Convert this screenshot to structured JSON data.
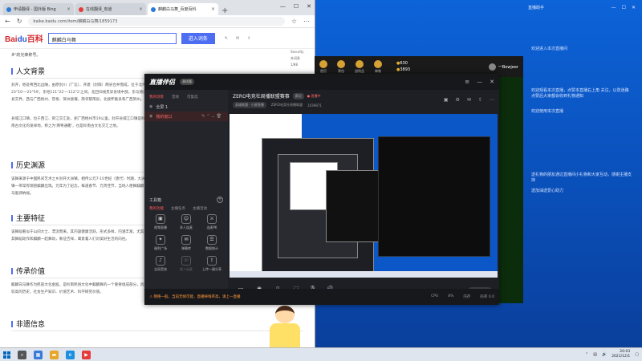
{
  "browser": {
    "tabs": [
      {
        "label": "申请翻译 - 国外版 Bing"
      },
      {
        "label": "在线翻译_有道"
      },
      {
        "label": "麒麟白马舞_百度百科"
      }
    ],
    "url": "baike.baidu.com/item/麒麟白马舞/1859173",
    "search_value": "麒麟白马舞",
    "search_button": "进入词条",
    "intro": "乡'的光荣称号。",
    "side_links": [
      "Security",
      "本词条",
      "1/88"
    ],
    "sections": [
      {
        "title": "人文背景",
        "text": "封开，地处粤西北边陲，由原封川（广信）、开建（封阳）两县合并而成，位于北纬23°10′一23°59′，东经111°22′一112°2′之间。北回归线贯穿县境中部，东与德庆县交界，西与广西梧州、苍梧、贺州接壤，南邻郁南县，北接怀集县和广西贺州。"
      },
      {
        "title": "",
        "text": "县城江口镇，位于西江、贺江交汇处，扼广西梧州市19公里。封开县城江口镇是岭南古文化的发祥地，称之为'两粤通衢'，也是岭南古文化交汇之地。"
      },
      {
        "title": "历史渊源",
        "text": "该舞来源于中国民间艺术之乡封开大洲镇，相传公元7-10世纪（唐代）时期，大洲镇一带常有瑞兽麒麟出现。元年为了纪念，每逢春节、元宵佳节，当地人便舞麒麟白马驱邪纳福。"
      },
      {
        "title": "主要特征",
        "text": "该舞蹈看似于山间大士、漂流而来。其内容健康活跃，形式多样，内涵丰富，尤其是其舞蹈动作和麒麟一起舞动，象征吉祥，寓意着人们对美好生活的向往。"
      },
      {
        "title": "传承价值",
        "text": "麒麟白马舞作为民族文化金瓯，是岭南民俗文化中麒麟舞的一个重要组成部分，具有较高的历史、社会生产知识、价值艺术、科学研究价值。"
      },
      {
        "title": "非遗信息",
        "text": ""
      }
    ]
  },
  "streamapp": {
    "logo": "直播伴侣",
    "version_badge": "测试版",
    "side_tabs": [
      "我的场景",
      "音效",
      "可复选"
    ],
    "scenes": [
      {
        "label": "全屏 1"
      },
      {
        "label": "我的窗口"
      }
    ],
    "tools_title": "工具箱",
    "tool_tabs": [
      "我的功能",
      "主播任务",
      "主播活动"
    ],
    "tools": [
      {
        "label": "视频直播",
        "icon": "▣"
      },
      {
        "label": "多人连麦",
        "icon": "☺"
      },
      {
        "label": "连麦PK",
        "icon": "⚔"
      },
      {
        "label": "福利广场",
        "icon": "✦"
      },
      {
        "label": "弹幕库",
        "icon": "✉"
      },
      {
        "label": "数据统计",
        "icon": "☰"
      },
      {
        "label": "全局音效",
        "icon": "♪"
      },
      {
        "label": "超人连麦",
        "icon": "☏"
      },
      {
        "label": "上传一键分享",
        "icon": "⇪"
      }
    ],
    "room_title": "ZERO电竞社周播联盟赛事",
    "room_tag": "赛况",
    "live_status": "● 直播中",
    "room_sub_tags": [
      "英雄联盟 · 小屏直播",
      "ZERO电竞社周播联盟",
      "1039871"
    ],
    "bottom_tools": [
      {
        "label": "直播画面",
        "icon": "▭"
      },
      {
        "label": "摄像头",
        "icon": "◉"
      },
      {
        "label": "手机投屏",
        "icon": "▯"
      },
      {
        "label": "投屏录",
        "icon": "⬚"
      },
      {
        "label": "麦克风",
        "icon": "🎙"
      },
      {
        "label": "扬声器",
        "icon": "🔊"
      }
    ],
    "start_live": "开始直播",
    "status_warning": "⚠ 网络一般，当前无帧可能，直播掉线率高，请上一直播",
    "status_right": [
      "CPU",
      "8%",
      "内存",
      "码率 0.0"
    ]
  },
  "game": {
    "icons": [
      "首页",
      "背包",
      "战利品",
      "神装"
    ],
    "coins": [
      "630",
      "3893"
    ],
    "user": "一Bowjeer"
  },
  "chat": {
    "title": "直播助手",
    "messages": [
      "欢迎进入本次直播间",
      "欢迎观看本次直播，点赞本直播右上角 关注，以防迷路 点赞后大家都会收到礼物通知",
      "欢迎使用本次直播",
      "送礼物的朋友通过直播间小礼物和大家互动，感谢主播支持",
      "送加油送爱心助力"
    ]
  },
  "clock": {
    "time": "20:03",
    "date": "2021/12/1"
  }
}
